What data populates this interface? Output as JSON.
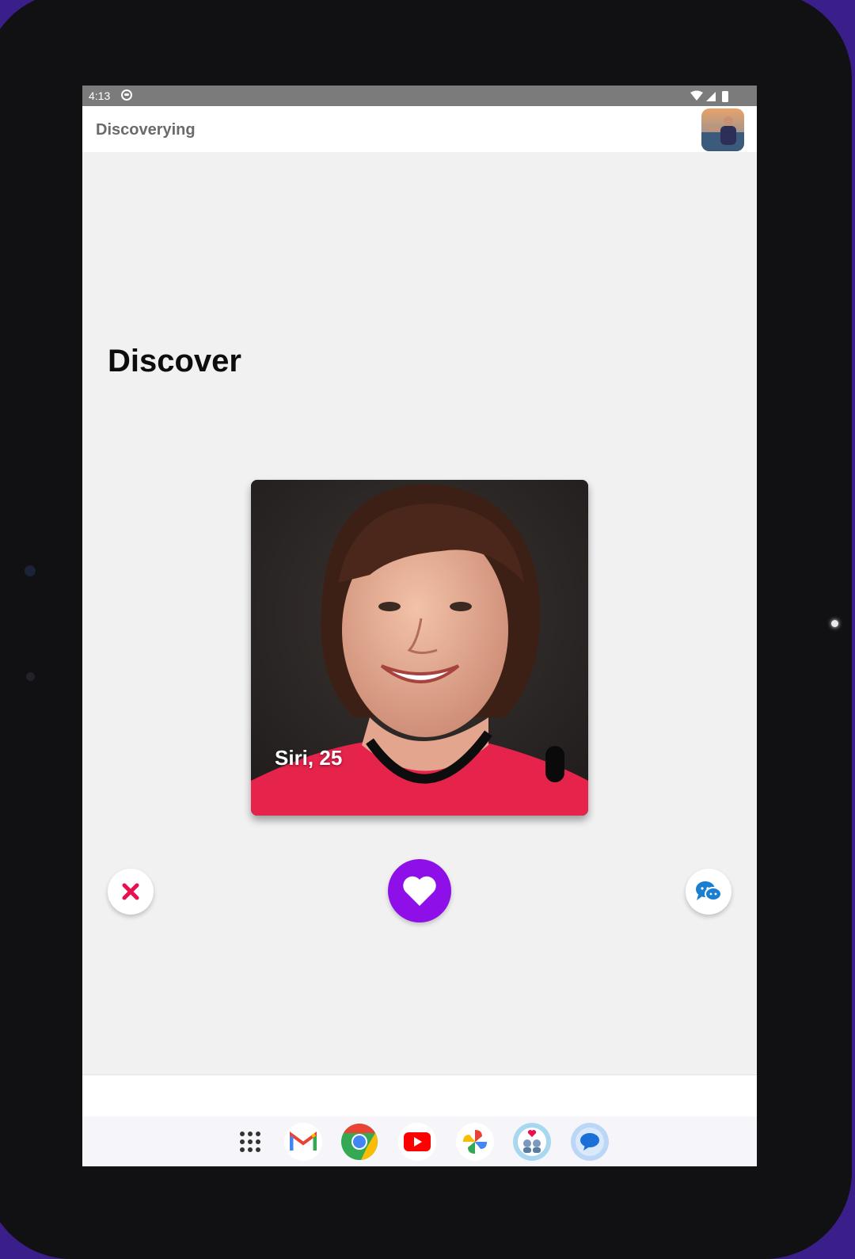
{
  "status_bar": {
    "time": "4:13",
    "app_icon": "app-notification-icon"
  },
  "app_bar": {
    "title": "Discoverying",
    "avatar_icon": "profile-avatar-icon"
  },
  "page": {
    "title": "Discover"
  },
  "card": {
    "name_age": "Siri, 25",
    "photo": "profile-photo"
  },
  "actions": {
    "dislike_icon": "close-x-icon",
    "like_icon": "heart-icon",
    "chat_icon": "chat-bubbles-icon"
  },
  "dock": {
    "apps": [
      "app-drawer",
      "gmail",
      "chrome",
      "youtube",
      "photos",
      "dating-app",
      "messages"
    ]
  },
  "colors": {
    "accent_purple": "#8e0fe8",
    "dislike_red": "#e8104f",
    "chat_blue": "#1a7fd0",
    "status_bar": "#7b7b7b",
    "background": "#f1f1f1"
  }
}
